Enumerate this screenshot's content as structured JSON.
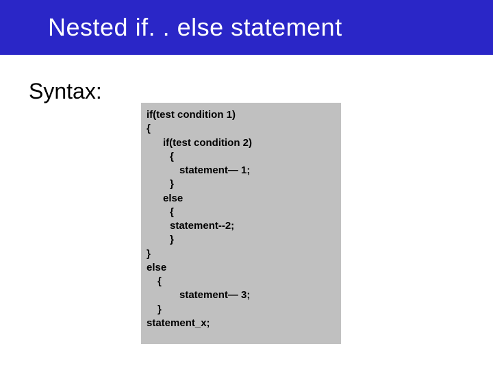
{
  "header": {
    "title": "Nested if. . else statement"
  },
  "syntax_label": "Syntax:",
  "code": {
    "l01": "if(test condition 1)",
    "l02": "{",
    "l03": "if(test condition 2)",
    "l04": "{",
    "l05": "statement— 1;",
    "l06": "}",
    "l07": "else",
    "l08": "{",
    "l09": "statement--2;",
    "l10": "}",
    "l11": "}",
    "l12": "else",
    "l13": "{",
    "l14": "statement— 3;",
    "l15": "}",
    "l16": "statement_x;"
  }
}
